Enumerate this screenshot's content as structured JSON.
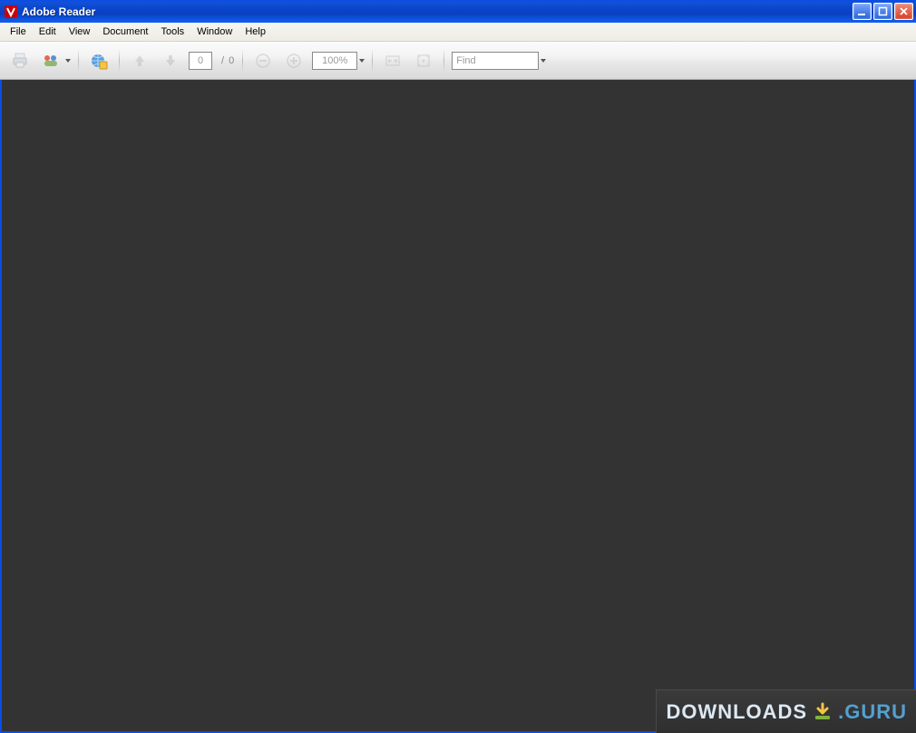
{
  "titlebar": {
    "app_title": "Adobe Reader"
  },
  "menubar": {
    "items": [
      "File",
      "Edit",
      "View",
      "Document",
      "Tools",
      "Window",
      "Help"
    ]
  },
  "toolbar": {
    "page_input_value": "0",
    "page_total_text": "/ 0",
    "zoom_text": "100%",
    "find_placeholder": "Find"
  },
  "watermark": {
    "left": "DOWNLOADS",
    "right": ".GURU"
  }
}
